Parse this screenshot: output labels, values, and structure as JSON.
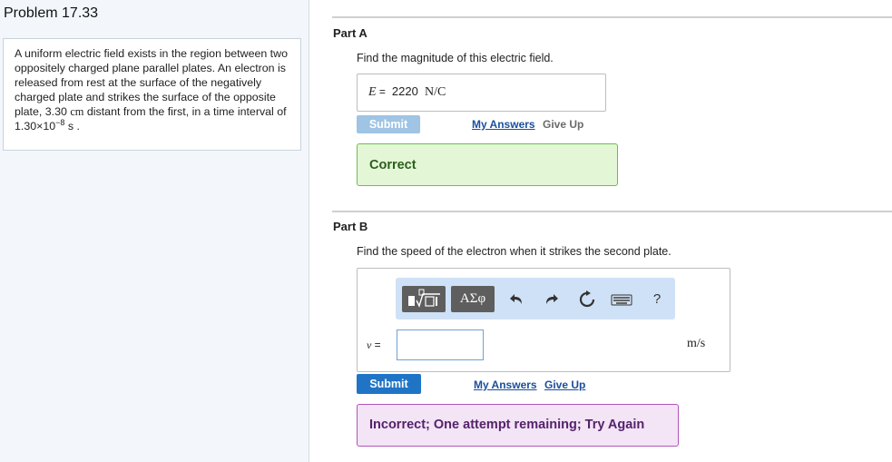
{
  "problem": {
    "title": "Problem 17.33",
    "text_part1": "A uniform electric field exists in the region between two oppositely charged plane parallel plates. An electron is released from rest at the surface of the negatively charged plate and strikes the surface of the opposite plate, 3.30 ",
    "text_unit_cm": "cm",
    "text_part2": " distant from the first, in a time interval of 1.30×10",
    "text_exponent": "−8",
    "text_part3": " s ."
  },
  "partA": {
    "label": "Part A",
    "question": "Find the magnitude of this electric field.",
    "variable": "E",
    "equals": " = ",
    "value": "2220",
    "unit": "N/C",
    "submit_label": "Submit",
    "my_answers_label": "My Answers",
    "give_up_label": "Give Up",
    "feedback": "Correct",
    "colors": {
      "correct_bg": "#e3f7d7",
      "correct_border": "#6bbf4a"
    }
  },
  "partB": {
    "label": "Part B",
    "question": "Find the speed of the electron when it strikes the second plate.",
    "toolbar": {
      "symbols_label": "ΑΣφ",
      "icons": [
        "templates-icon",
        "undo-icon",
        "redo-icon",
        "reset-icon",
        "keyboard-icon",
        "help-icon"
      ],
      "help_label": "?"
    },
    "variable": "v",
    "equals": " =",
    "input_value": "",
    "unit": "m/s",
    "submit_label": "Submit",
    "my_answers_label": "My Answers",
    "give_up_label": "Give Up",
    "feedback": "Incorrect; One attempt remaining; Try Again",
    "colors": {
      "submit_bg": "#1f74c6",
      "incorrect_bg": "#f3e4f6",
      "incorrect_border": "#b055b8"
    }
  }
}
